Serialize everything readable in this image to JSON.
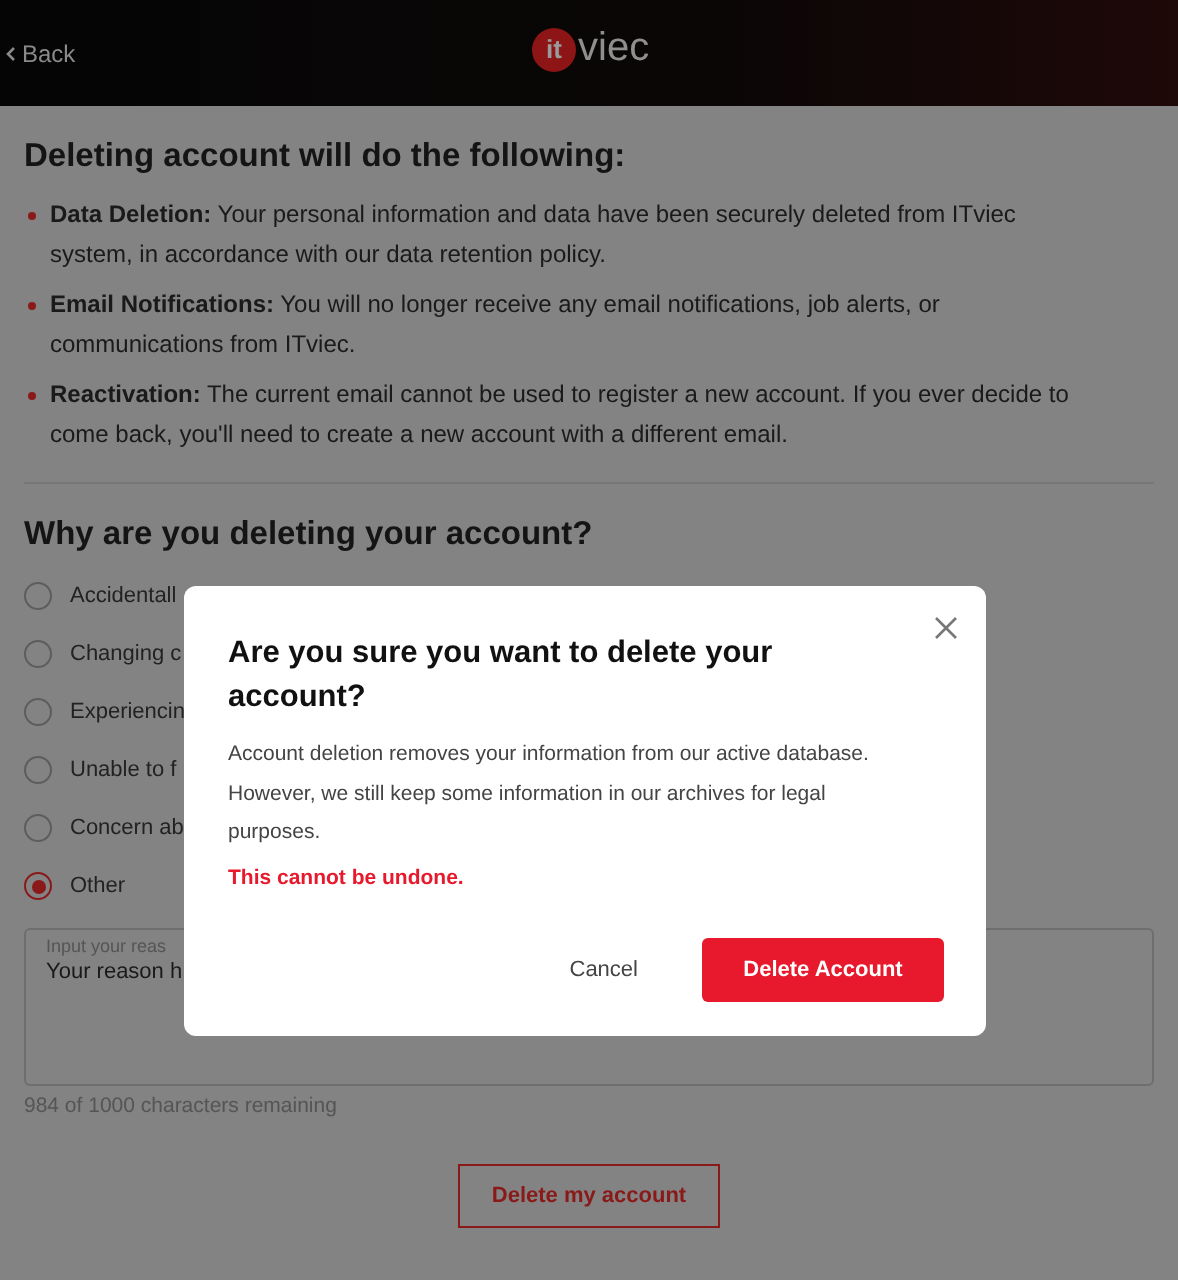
{
  "header": {
    "back_label": "Back",
    "logo": {
      "badge": "it",
      "text": "viec"
    }
  },
  "effects": {
    "title": "Deleting account will do the following:",
    "items": [
      {
        "text": "**Data Deletion:** Your personal information and data have been securely deleted from ITviec system, in accordance with our data retention policy."
      },
      {
        "text": "**Email Notifications:** You will no longer receive any email notifications, job alerts, or communications from ITviec."
      },
      {
        "text": "**Reactivation:** The current email cannot be used to register a new account. If you ever decide to come back, you'll need to create a new account with a different email."
      }
    ]
  },
  "reasons": {
    "title": "Why are you deleting your account?",
    "options": [
      {
        "label": "Accidentall",
        "selected": false
      },
      {
        "label": "Changing c",
        "selected": false
      },
      {
        "label": "Experiencin",
        "selected": false
      },
      {
        "label": "Unable to f",
        "selected": false
      },
      {
        "label": "Concern ab",
        "selected": false
      },
      {
        "label": "Other",
        "selected": true
      }
    ],
    "reason_field": {
      "label": "Input your reas",
      "value": "Your reason h"
    },
    "counter": "984 of 1000 characters remaining"
  },
  "delete_button": "Delete my account",
  "dialog": {
    "title": "Are you sure you want to delete your account?",
    "body": "Account deletion removes your information from our active database. However, we still keep some information in our archives for legal purposes.",
    "warning": "This cannot be undone.",
    "cancel": "Cancel",
    "confirm": "Delete Account"
  }
}
